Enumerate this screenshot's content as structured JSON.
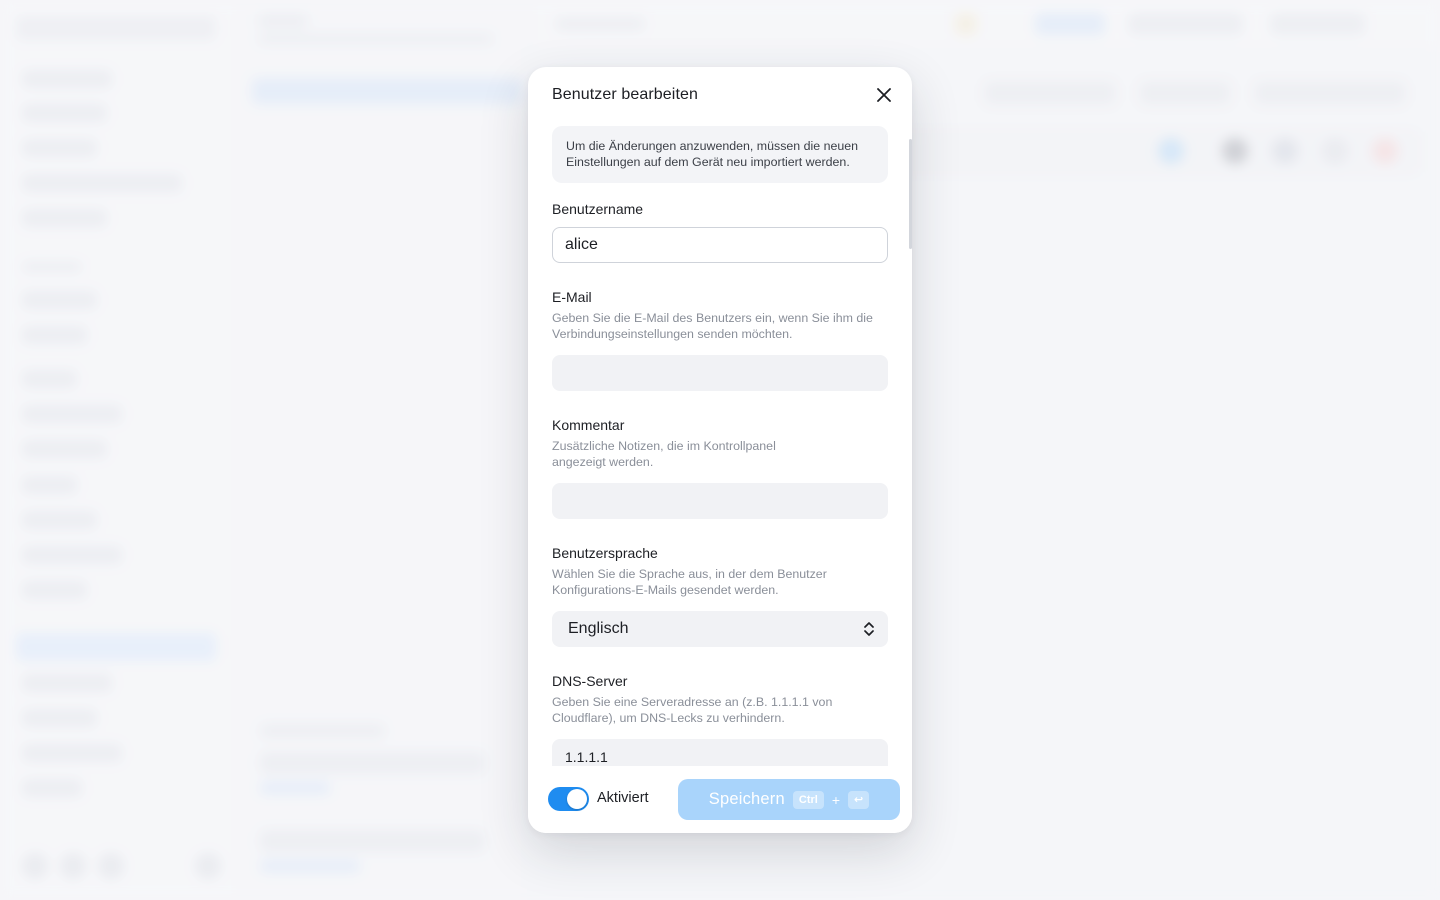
{
  "modal": {
    "title": "Benutzer bearbeiten",
    "notice": "Um die Änderungen anzuwenden, müssen die neuen Einstellungen auf dem Gerät neu importiert werden.",
    "fields": {
      "username": {
        "label": "Benutzername",
        "value": "alice"
      },
      "email": {
        "label": "E-Mail",
        "help": "Geben Sie die E-Mail des Benutzers ein, wenn Sie ihm die Verbindungseinstellungen senden möchten.",
        "value": ""
      },
      "comment": {
        "label": "Kommentar",
        "help": "Zusätzliche Notizen, die im Kontrollpanel angezeigt werden.",
        "value": ""
      },
      "language": {
        "label": "Benutzersprache",
        "help": "Wählen Sie die Sprache aus, in der dem Benutzer Konfigurations-E-Mails gesendet werden.",
        "selected": "Englisch"
      },
      "dns": {
        "label": "DNS-Server",
        "help": "Geben Sie eine Serveradresse an (z.B. 1.1.1.1 von Cloudflare), um DNS-Lecks zu verhindern.",
        "value": "1.1.1.1"
      }
    },
    "footer": {
      "toggle_label": "Aktiviert",
      "toggle_on": true,
      "save_label": "Speichern",
      "shortcut_key": "Ctrl",
      "shortcut_plus": "+",
      "shortcut_enter": "↩"
    }
  },
  "colors": {
    "accent": "#1f8cf0",
    "save_button": "#a9d4fb",
    "notice_bg": "#f3f4f7"
  },
  "icons": {
    "close": "close-icon",
    "select": "chevron-up-down-icon",
    "enter": "enter-key-icon"
  }
}
